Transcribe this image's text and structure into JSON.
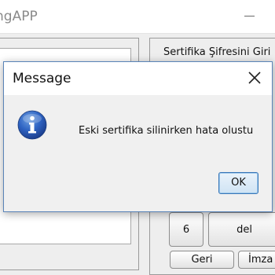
{
  "window": {
    "title": "ngAPP"
  },
  "left_panel": {
    "ghost_text": "............"
  },
  "right_panel": {
    "label": "Sertifika Şifresini Giri",
    "keypad": {
      "six": "6",
      "del": "del",
      "seven": ""
    },
    "back_label": "Geri",
    "sign_label": "İmza"
  },
  "dialog": {
    "title": "Message",
    "icon": "info-icon",
    "message": "Eski sertifika silinirken hata olustu",
    "ok_label": "OK"
  }
}
